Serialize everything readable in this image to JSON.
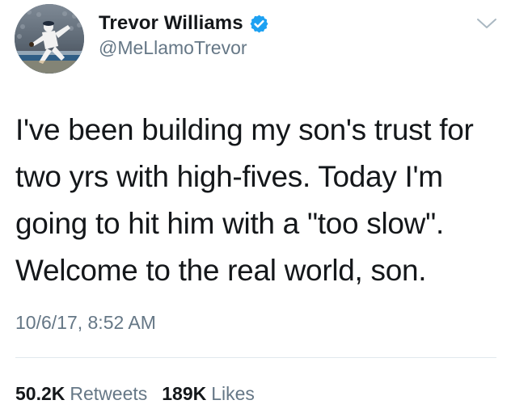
{
  "author": {
    "display_name": "Trevor Williams",
    "handle": "@MeLlamoTrevor",
    "verified": true,
    "avatar_icon": "baseball-pitcher-avatar"
  },
  "tweet": {
    "text": "I've been building my son's trust for\ntwo yrs with high-fives. Today I'm\ngoing to hit him with a \"too slow\".\nWelcome to the real world, son.",
    "timestamp": "10/6/17, 8:52 AM"
  },
  "stats": {
    "retweets_count": "50.2K",
    "retweets_label": "Retweets",
    "likes_count": "189K",
    "likes_label": "Likes"
  },
  "colors": {
    "verified_badge": "#1da1f2",
    "secondary_text": "#657786",
    "primary_text": "#14171a",
    "divider": "#e1e8ed"
  },
  "icons": {
    "menu": "chevron-down-icon",
    "verified": "verified-badge-icon"
  }
}
